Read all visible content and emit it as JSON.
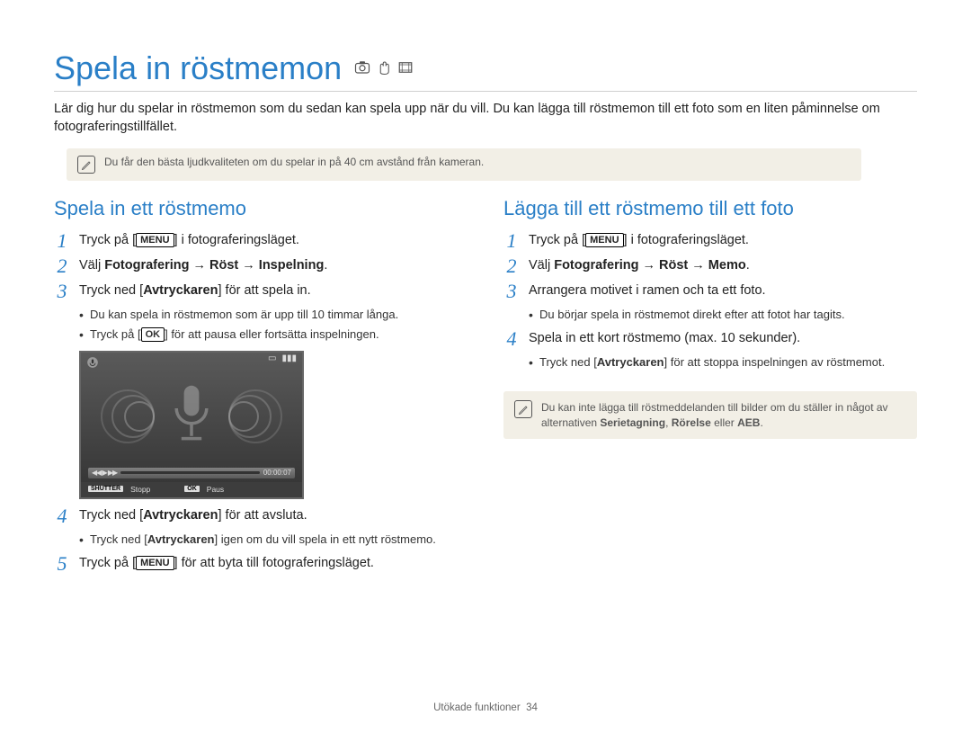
{
  "page_title": "Spela in röstmemon",
  "intro_text": "Lär dig hur du spelar in röstmemon som du sedan kan spela upp när du vill. Du kan lägga till röstmemon till ett foto som en liten påminnelse om fotograferingstillfället.",
  "tip_full": "Du får den bästa ljudkvaliteten om du spelar in på 40 cm avstånd från kameran.",
  "tip_col_right_part1": "Du kan inte lägga till röstmeddelanden till bilder om du ställer in något av alternativen ",
  "tip_col_right_bold1": "Serietagning",
  "tip_col_right_sep1": ", ",
  "tip_col_right_bold2": "Rörelse",
  "tip_col_right_sep2": " eller ",
  "tip_col_right_bold3": "AEB",
  "tip_col_right_tail": ".",
  "kbd": {
    "menu": "MENU",
    "ok": "OK",
    "shutter": "SHUTTER"
  },
  "left": {
    "heading": "Spela in ett röstmemo",
    "step1_pre": "Tryck på [",
    "step1_post": "] i fotograferingsläget.",
    "step2_pre": "Välj ",
    "step2_bold": "Fotografering → Röst → Inspelning",
    "step2_post": ".",
    "step3_pre": "Tryck ned [",
    "step3_mid": "Avtryckaren",
    "step3_post": "] för att spela in.",
    "step3_b1": "Du kan spela in röstmemon som är upp till 10 timmar långa.",
    "step3_b2_pre": "Tryck på [",
    "step3_b2_post": "] för att pausa eller fortsätta inspelningen.",
    "illus": {
      "time": "00:00:07",
      "stop": "Stopp",
      "pause": "Paus"
    },
    "step4_pre": "Tryck ned [",
    "step4_mid": "Avtryckaren",
    "step4_post": "] för att avsluta.",
    "step4_b_pre": "Tryck ned [",
    "step4_b_mid": "Avtryckaren",
    "step4_b_post": "] igen om du vill spela in ett nytt röstmemo.",
    "step5_pre": "Tryck på [",
    "step5_post": "] för att byta till fotograferingsläget."
  },
  "right": {
    "heading": "Lägga till ett röstmemo till ett foto",
    "step1_pre": "Tryck på [",
    "step1_post": "] i fotograferingsläget.",
    "step2_pre": "Välj ",
    "step2_bold": "Fotografering → Röst → Memo",
    "step2_post": ".",
    "step3": "Arrangera motivet i ramen och ta ett foto.",
    "step3_b1": "Du börjar spela in röstmemot direkt efter att fotot har tagits.",
    "step4": "Spela in ett kort röstmemo (max. 10 sekunder).",
    "step4_b_pre": "Tryck ned [",
    "step4_b_mid": "Avtryckaren",
    "step4_b_post": "] för att stoppa inspelningen av röstmemot."
  },
  "footer_label": "Utökade funktioner",
  "footer_page": "34"
}
